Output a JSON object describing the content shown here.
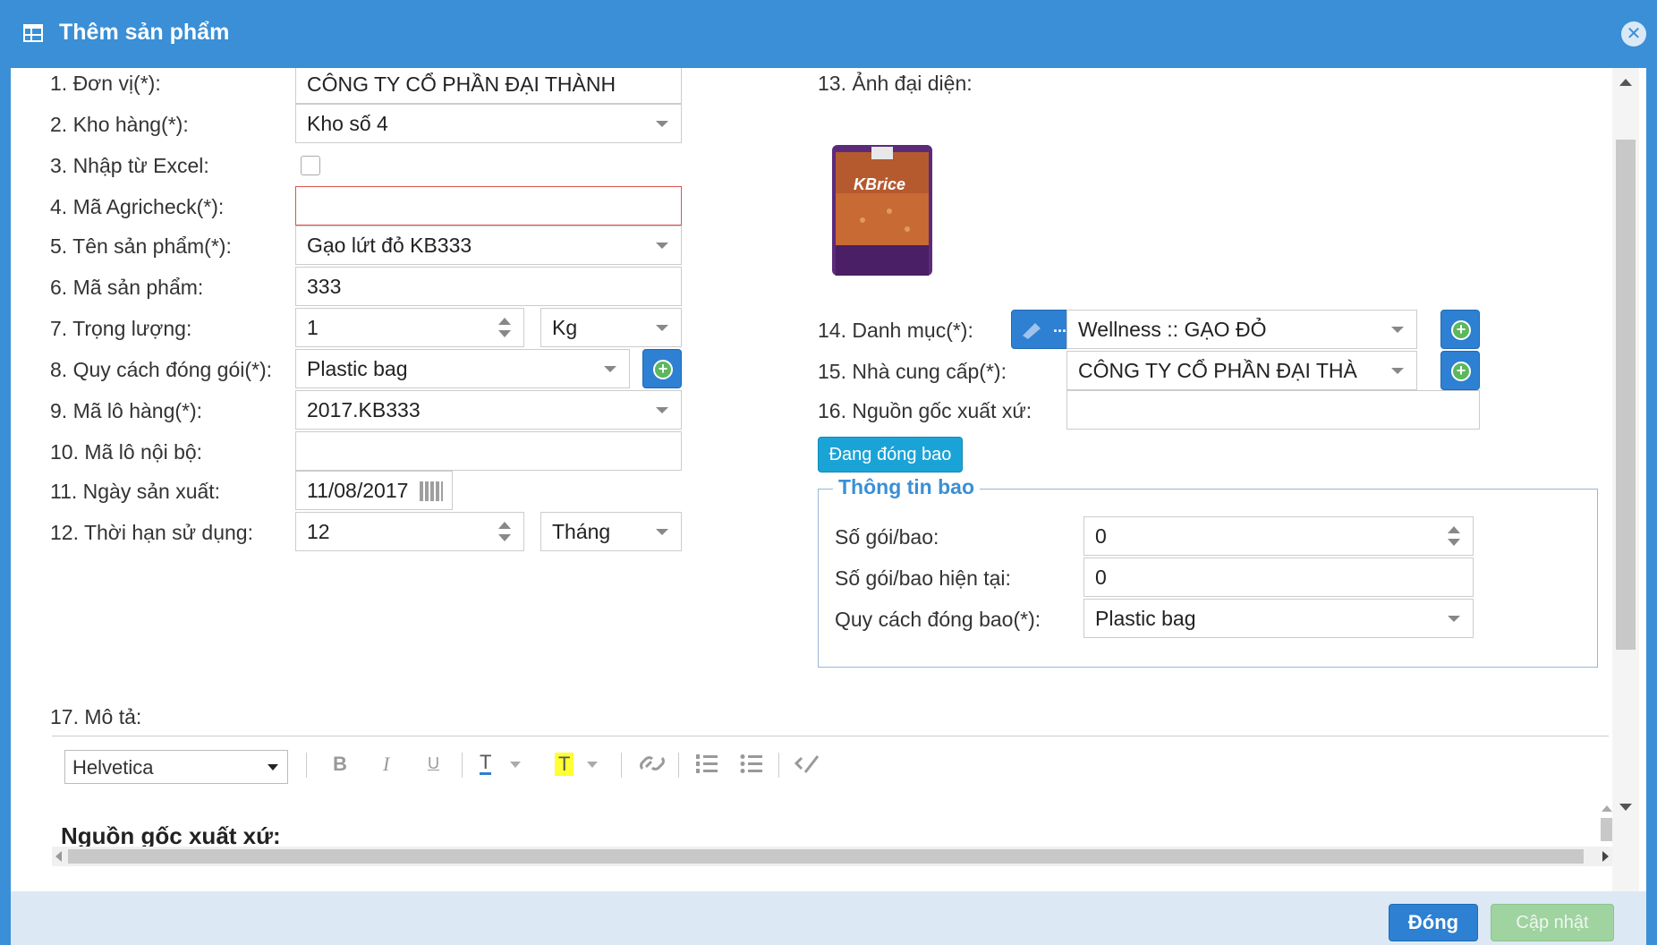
{
  "dialog": {
    "title": "Thêm sản phẩm",
    "close_symbol": "✕"
  },
  "left_form": {
    "don_vi": {
      "label": "1. Đơn vị(*):",
      "value": "CÔNG TY CỔ PHẦN ĐẠI THÀNH"
    },
    "kho_hang": {
      "label": "2. Kho hàng(*):",
      "value": "Kho số 4"
    },
    "nhap_excel": {
      "label": "3. Nhập từ Excel:"
    },
    "ma_agricheck": {
      "label": "4. Mã Agricheck(*):",
      "value": ""
    },
    "ten_san_pham": {
      "label": "5. Tên sản phẩm(*):",
      "value": "Gạo lứt đỏ KB333"
    },
    "ma_san_pham": {
      "label": "6. Mã sản phẩm:",
      "value": "333"
    },
    "trong_luong": {
      "label": "7. Trọng lượng:",
      "value": "1",
      "unit": "Kg"
    },
    "quy_cach": {
      "label": "8. Quy cách đóng gói(*):",
      "value": "Plastic bag"
    },
    "ma_lo_hang": {
      "label": "9. Mã lô hàng(*):",
      "value": "2017.KB333"
    },
    "ma_lo_noi_bo": {
      "label": "10. Mã lô nội bộ:",
      "value": ""
    },
    "ngay_san_xuat": {
      "label": "11. Ngày sản xuất:",
      "value": "11/08/2017"
    },
    "thoi_han": {
      "label": "12. Thời hạn sử dụng:",
      "value": "12",
      "unit": "Tháng"
    }
  },
  "right_form": {
    "anh_dai_dien": {
      "label": "13. Ảnh đại diện:",
      "edit_label": "...",
      "image_brand": "KBrice"
    },
    "danh_muc": {
      "label": "14. Danh mục(*):",
      "value": "Wellness :: GẠO ĐỎ"
    },
    "nha_cung_cap": {
      "label": "15. Nhà cung cấp(*):",
      "value": "CÔNG TY CỔ PHẦN ĐẠI THÀ"
    },
    "nguon_goc": {
      "label": "16. Nguồn gốc xuất xứ:",
      "value": ""
    },
    "dang_dong_bao_btn": "Đang đóng bao",
    "thong_tin_bao": {
      "legend": "Thông tin bao",
      "so_goi_bao": {
        "label": "Số gói/bao:",
        "value": "0"
      },
      "so_goi_hien_tai": {
        "label": "Số gói/bao hiện tại:",
        "value": "0"
      },
      "quy_cach_dong_bao": {
        "label": "Quy cách đóng bao(*):",
        "value": "Plastic bag"
      }
    }
  },
  "mo_ta": {
    "label": "17. Mô tả:",
    "font": "Helvetica",
    "toolbar": {
      "bold": "B",
      "italic": "I",
      "underline": "U",
      "color": "T",
      "highlight": "T"
    },
    "content": "Nguồn gốc xuất xứ:"
  },
  "footer": {
    "close_label": "Đóng",
    "update_label": "Cập nhật"
  },
  "colors": {
    "primary": "#3a8fd6",
    "footer_bg": "#dce9f5",
    "success_disabled": "#9fd3a0"
  }
}
